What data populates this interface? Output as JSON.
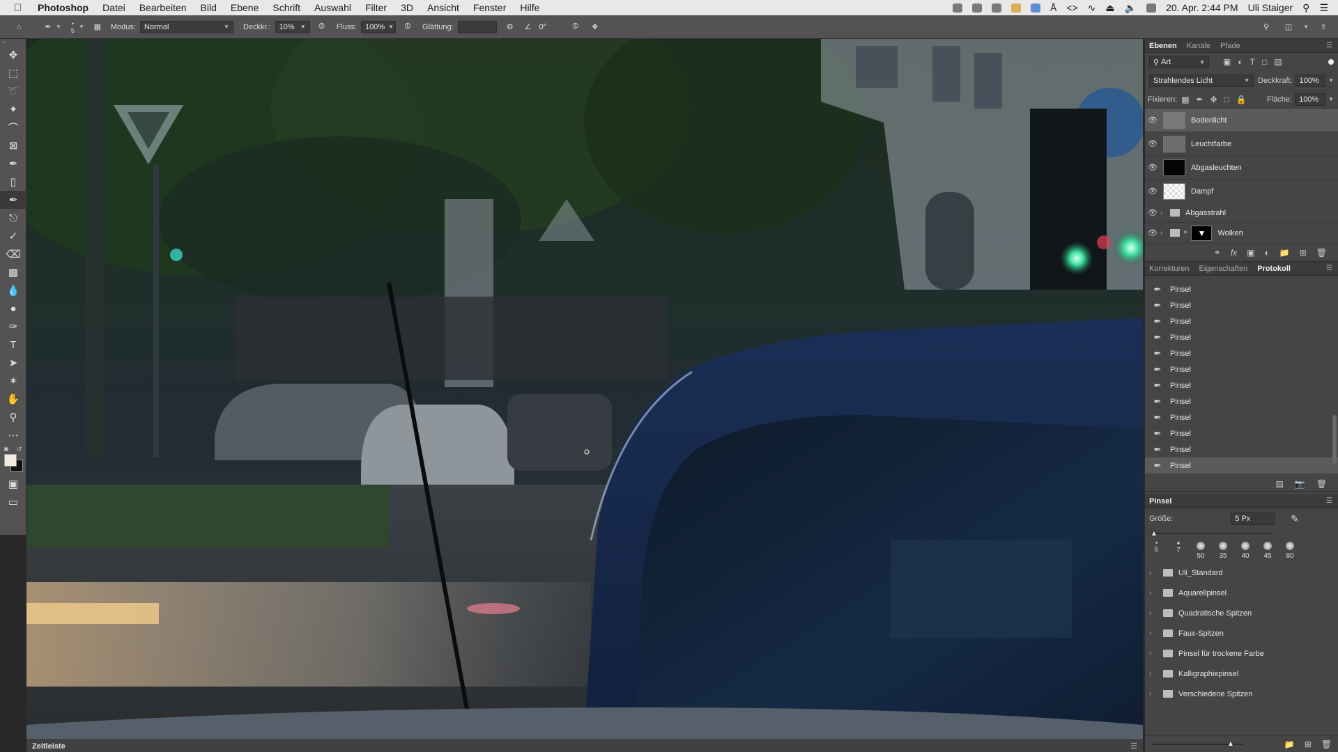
{
  "menubar": {
    "app_name": "Photoshop",
    "items": [
      "Datei",
      "Bearbeiten",
      "Bild",
      "Ebene",
      "Schrift",
      "Auswahl",
      "Filter",
      "3D",
      "Ansicht",
      "Fenster",
      "Hilfe"
    ],
    "clock": "20. Apr. 2:44 PM",
    "user": "Uli Staiger"
  },
  "options": {
    "brush_size": "5",
    "mode_label": "Modus:",
    "mode_value": "Normal",
    "opacity_label": "Deckkr.:",
    "opacity_value": "10%",
    "flow_label": "Fluss:",
    "flow_value": "100%",
    "smoothing_label": "Glättung:",
    "smoothing_value": "",
    "angle_value": "0°"
  },
  "layers_panel": {
    "tabs": [
      "Ebenen",
      "Kanäle",
      "Pfade"
    ],
    "filter_label": "Art",
    "blend_mode": "Strahlendes Licht",
    "opacity_label": "Deckkraft:",
    "opacity_value": "100%",
    "lock_label": "Fixieren:",
    "fill_label": "Fläche:",
    "fill_value": "100%",
    "layers": [
      {
        "name": "Bodenlicht",
        "selected": true
      },
      {
        "name": "Leuchtfarbe"
      },
      {
        "name": "Abgasleuchten"
      },
      {
        "name": "Dampf"
      },
      {
        "name": "Abgasstrahl"
      },
      {
        "name": "Wolken"
      }
    ]
  },
  "history_panel": {
    "tabs": [
      "Korrekturen",
      "Eigenschaften",
      "Protokoll"
    ],
    "steps": [
      "Pinsel",
      "Pinsel",
      "Pinsel",
      "Pinsel",
      "Pinsel",
      "Pinsel",
      "Pinsel",
      "Pinsel",
      "Pinsel",
      "Pinsel",
      "Pinsel",
      "Pinsel"
    ]
  },
  "brush_panel": {
    "title": "Pinsel",
    "size_label": "Größe:",
    "size_value": "5 Px",
    "presets": [
      "5",
      "7",
      "50",
      "35",
      "40",
      "45",
      "80"
    ],
    "folders": [
      "Uli_Standard",
      "Aquarellpinsel",
      "Quadratische Spitzen",
      "Faux-Spitzen",
      "Pinsel für trockene Farbe",
      "Kalligraphiepinsel",
      "Verschiedene Spitzen"
    ]
  },
  "timeline": {
    "label": "Zeitleiste"
  }
}
